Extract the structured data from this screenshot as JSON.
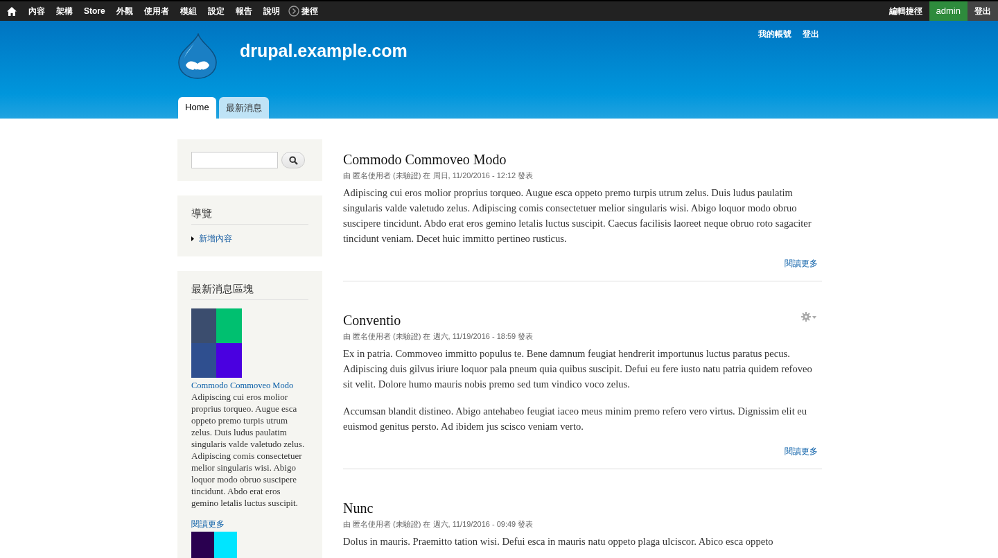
{
  "toolbar": {
    "menu": [
      {
        "label": "內容"
      },
      {
        "label": "架構"
      },
      {
        "label": "Store"
      },
      {
        "label": "外觀"
      },
      {
        "label": "使用者"
      },
      {
        "label": "模組"
      },
      {
        "label": "設定"
      },
      {
        "label": "報告"
      },
      {
        "label": "說明"
      }
    ],
    "shortcuts": {
      "label": "捷徑"
    },
    "edit_shortcuts": "編輯捷徑",
    "user": "admin",
    "logout": "登出"
  },
  "header": {
    "site_name": "drupal.example.com",
    "secondary_menu": [
      "我的帳號",
      "登出"
    ],
    "tabs": [
      {
        "label": "Home",
        "selected": true
      },
      {
        "label": "最新消息",
        "selected": false
      }
    ]
  },
  "sidebar": {
    "navigation": {
      "title": "導覽",
      "items": [
        "新增內容"
      ]
    },
    "news_block": {
      "title": "最新消息區塊",
      "items": [
        {
          "title": "Commodo Commoveo Modo",
          "text": "Adipiscing cui eros molior proprius torqueo. Augue esca oppeto premo turpis utrum zelus. Duis ludus paulatim singularis valde valetudo zelus. Adipiscing comis consectetuer melior singularis wisi. Abigo loquor modo obruo suscipere tincidunt. Abdo erat eros gemino letalis luctus suscipit.",
          "more": "閱讀更多"
        }
      ]
    }
  },
  "articles": [
    {
      "title": "Commodo Commoveo Modo",
      "meta": "由 匿名使用者 (未驗證) 在 周日, 11/20/2016 - 12:12 發表",
      "contextual_links": false,
      "paragraphs": [
        "Adipiscing cui eros molior proprius torqueo. Augue esca oppeto premo turpis utrum zelus. Duis ludus paulatim singularis valde valetudo zelus. Adipiscing comis consectetuer melior singularis wisi. Abigo loquor modo obruo suscipere tincidunt. Abdo erat eros gemino letalis luctus suscipit. Caecus facilisis laoreet neque obruo roto sagaciter tincidunt veniam. Decet huic immitto pertineo rusticus."
      ],
      "more": "閱讀更多"
    },
    {
      "title": "Conventio",
      "meta": "由 匿名使用者 (未驗證) 在 週六, 11/19/2016 - 18:59 發表",
      "contextual_links": true,
      "paragraphs": [
        "Ex in patria. Commoveo immitto populus te. Bene damnum feugiat hendrerit importunus luctus paratus pecus. Adipiscing duis gilvus iriure loquor pala pneum quia quibus suscipit. Defui eu fere iusto natu patria quidem refoveo sit velit. Dolore humo mauris nobis premo sed tum vindico voco zelus.",
        "Accumsan blandit distineo. Abigo antehabeo feugiat iaceo meus minim premo refero vero virtus. Dignissim elit eu euismod genitus persto. Ad ibidem jus scisco veniam verto."
      ],
      "more": "閱讀更多"
    },
    {
      "title": "Nunc",
      "meta": "由 匿名使用者 (未驗證) 在 週六, 11/19/2016 - 09:49 發表",
      "contextual_links": false,
      "paragraphs": [
        "Dolus in mauris. Praemitto tation wisi. Defui esca in mauris natu oppeto plaga ulciscor. Abico esca oppeto"
      ]
    }
  ]
}
